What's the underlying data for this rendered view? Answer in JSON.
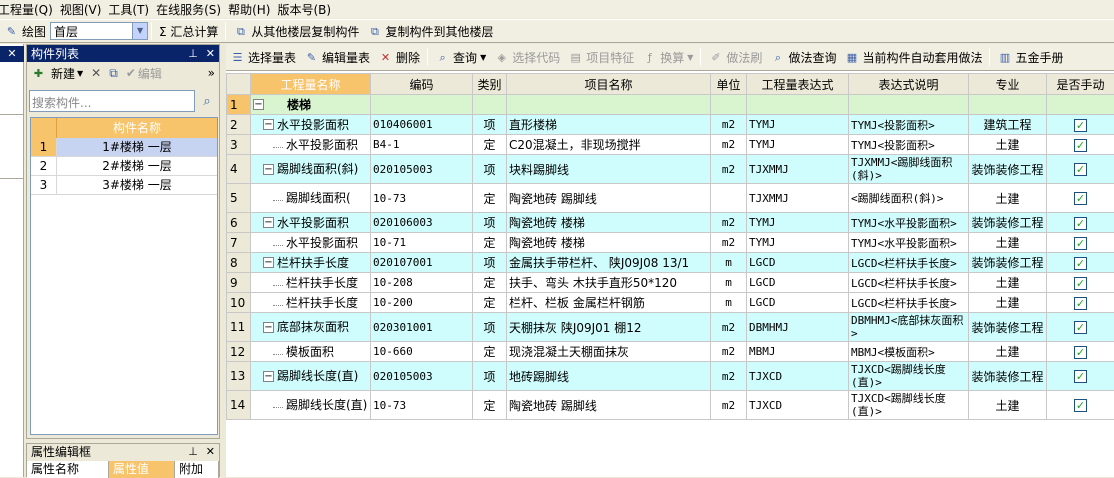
{
  "menu": [
    "工程量(Q)",
    "视图(V)",
    "工具(T)",
    "在线服务(S)",
    "帮助(H)",
    "版本号(B)"
  ],
  "toolbar1": {
    "draw": "绘图",
    "floor": "首层",
    "summary": "Σ 汇总计算",
    "copy_from": "从其他楼层复制构件",
    "copy_to": "复制构件到其他楼层"
  },
  "component_panel": {
    "title": "构件列表",
    "new_label": "新建",
    "edit_label": "编辑",
    "search_placeholder": "搜索构件...",
    "column_header": "构件名称",
    "items": [
      {
        "no": "1",
        "name": "1#楼梯 一层"
      },
      {
        "no": "2",
        "name": "2#楼梯 一层"
      },
      {
        "no": "3",
        "name": "3#楼梯 一层"
      }
    ]
  },
  "property_panel": {
    "title": "属性编辑框",
    "col_name": "属性名称",
    "col_value": "属性值",
    "col_extra": "附加"
  },
  "toolbar2": {
    "select_qty": "选择量表",
    "edit_qty": "编辑量表",
    "delete": "删除",
    "query": "查询",
    "select_code": "选择代码",
    "item_feature": "项目特征",
    "convert": "换算",
    "method_brush": "做法刷",
    "method_query": "做法查询",
    "auto_apply": "当前构件自动套用做法",
    "hardware": "五金手册"
  },
  "table": {
    "headers": [
      "工程量名称",
      "编码",
      "类别",
      "项目名称",
      "单位",
      "工程量表达式",
      "表达式说明",
      "专业",
      "是否手动"
    ],
    "rows": [
      {
        "no": "1",
        "level": 0,
        "name": "楼梯",
        "code": "",
        "type": "",
        "item": "",
        "unit": "",
        "expr": "",
        "desc": "",
        "major": "",
        "checked": false
      },
      {
        "no": "2",
        "level": 1,
        "name": "水平投影面积",
        "code": "010406001",
        "type": "项",
        "item": "直形楼梯",
        "unit": "m2",
        "expr": "TYMJ",
        "desc": "TYMJ<投影面积>",
        "major": "建筑工程",
        "checked": true
      },
      {
        "no": "3",
        "level": 2,
        "name": "水平投影面积",
        "code": "B4-1",
        "type": "定",
        "item": "C20混凝土，非现场搅拌",
        "unit": "m2",
        "expr": "TYMJ",
        "desc": "TYMJ<投影面积>",
        "major": "土建",
        "checked": true
      },
      {
        "no": "4",
        "level": 1,
        "name": "踢脚线面积(斜)",
        "code": "020105003",
        "type": "项",
        "item": "块料踢脚线",
        "unit": "m2",
        "expr": "TJXMMJ",
        "desc": "TJXMMJ<踢脚线面积(斜)>",
        "major": "装饰装修工程",
        "checked": true
      },
      {
        "no": "5",
        "level": 2,
        "name": "踢脚线面积(",
        "code": "10-73",
        "type": "定",
        "item": "陶瓷地砖 踢脚线",
        "unit": "",
        "expr": "TJXMMJ",
        "desc": "<踢脚线面积(斜)>",
        "major": "土建",
        "checked": true
      },
      {
        "no": "6",
        "level": 1,
        "name": "水平投影面积",
        "code": "020106003",
        "type": "项",
        "item": "陶瓷地砖 楼梯",
        "unit": "m2",
        "expr": "TYMJ",
        "desc": "TYMJ<水平投影面积>",
        "major": "装饰装修工程",
        "checked": true
      },
      {
        "no": "7",
        "level": 2,
        "name": "水平投影面积",
        "code": "10-71",
        "type": "定",
        "item": "陶瓷地砖 楼梯",
        "unit": "m2",
        "expr": "TYMJ",
        "desc": "TYMJ<水平投影面积>",
        "major": "土建",
        "checked": true
      },
      {
        "no": "8",
        "level": 1,
        "name": "栏杆扶手长度",
        "code": "020107001",
        "type": "项",
        "item": "金属扶手带栏杆、 陕J09J08 13/1",
        "unit": "m",
        "expr": "LGCD",
        "desc": "LGCD<栏杆扶手长度>",
        "major": "装饰装修工程",
        "checked": true
      },
      {
        "no": "9",
        "level": 2,
        "name": "栏杆扶手长度",
        "code": "10-208",
        "type": "定",
        "item": "扶手、弯头 木扶手直形50*120",
        "unit": "m",
        "expr": "LGCD",
        "desc": "LGCD<栏杆扶手长度>",
        "major": "土建",
        "checked": true
      },
      {
        "no": "10",
        "level": 2,
        "name": "栏杆扶手长度",
        "code": "10-200",
        "type": "定",
        "item": "栏杆、栏板 金属栏杆钢筋",
        "unit": "m",
        "expr": "LGCD",
        "desc": "LGCD<栏杆扶手长度>",
        "major": "土建",
        "checked": true
      },
      {
        "no": "11",
        "level": 1,
        "name": "底部抹灰面积",
        "code": "020301001",
        "type": "项",
        "item": "天棚抹灰 陕J09J01 棚12",
        "unit": "m2",
        "expr": "DBMHMJ",
        "desc": "DBMHMJ<底部抹灰面积>",
        "major": "装饰装修工程",
        "checked": true
      },
      {
        "no": "12",
        "level": 2,
        "name": "模板面积",
        "code": "10-660",
        "type": "定",
        "item": "现浇混凝土天棚面抹灰",
        "unit": "m2",
        "expr": "MBMJ",
        "desc": "MBMJ<模板面积>",
        "major": "土建",
        "checked": true
      },
      {
        "no": "13",
        "level": 1,
        "name": "踢脚线长度(直)",
        "code": "020105003",
        "type": "项",
        "item": "地砖踢脚线",
        "unit": "m2",
        "expr": "TJXCD",
        "desc": "TJXCD<踢脚线长度(直)>",
        "major": "装饰装修工程",
        "checked": true
      },
      {
        "no": "14",
        "level": 2,
        "name": "踢脚线长度(直)",
        "code": "10-73",
        "type": "定",
        "item": "陶瓷地砖 踢脚线",
        "unit": "m2",
        "expr": "TJXCD",
        "desc": "TJXCD<踢脚线长度(直)>",
        "major": "土建",
        "checked": true
      }
    ]
  },
  "colors": {
    "header_highlight": "#f7c36b",
    "category_row": "#cffcfc",
    "first_row": "#d9f5cf",
    "panel_title": "#0a246a"
  }
}
